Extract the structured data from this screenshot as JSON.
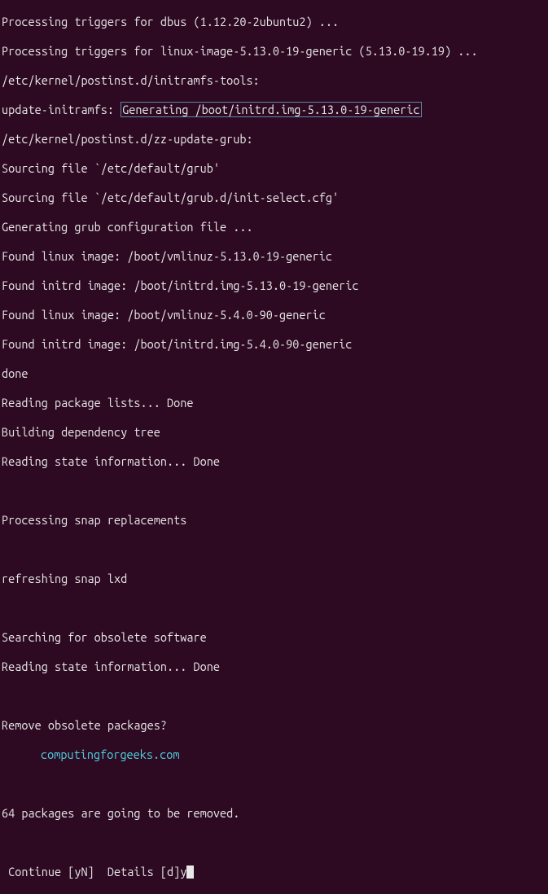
{
  "lines": [
    "Processing triggers for dbus (1.12.20-2ubuntu2) ...",
    "Processing triggers for linux-image-5.13.0-19-generic (5.13.0-19.19) ...",
    "/etc/kernel/postinst.d/initramfs-tools:"
  ],
  "line_highlight_prefix": "update-initramfs: ",
  "line_highlight": "Generating /boot/initrd.img-5.13.0-19-generic",
  "lines_after": [
    "/etc/kernel/postinst.d/zz-update-grub:",
    "Sourcing file `/etc/default/grub'",
    "Sourcing file `/etc/default/grub.d/init-select.cfg'",
    "Generating grub configuration file ...",
    "Found linux image: /boot/vmlinuz-5.13.0-19-generic",
    "Found initrd image: /boot/initrd.img-5.13.0-19-generic",
    "Found linux image: /boot/vmlinuz-5.4.0-90-generic",
    "Found initrd image: /boot/initrd.img-5.4.0-90-generic",
    "done",
    "Reading package lists... Done",
    "Building dependency tree",
    "Reading state information... Done",
    "",
    "Processing snap replacements",
    "",
    "refreshing snap lxd",
    "",
    "Searching for obsolete software",
    "Reading state information... Done",
    "",
    "Remove obsolete packages?"
  ],
  "watermark": "computingforgeeks.com",
  "lines_final": [
    "",
    "64 packages are going to be removed.",
    ""
  ],
  "prompt": " Continue [yN]  Details [d]",
  "user_input": "y"
}
